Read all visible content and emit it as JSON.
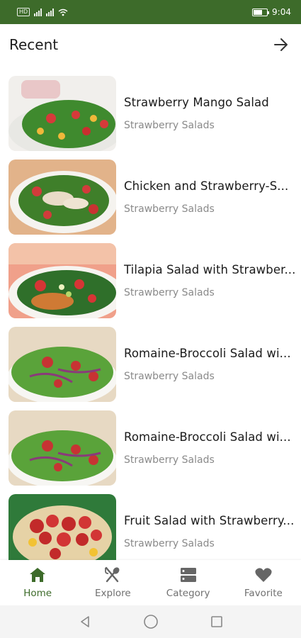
{
  "status_bar": {
    "left_badge": "HD",
    "time": "9:04",
    "icons": [
      "signal-icon",
      "signal-icon",
      "wifi-icon",
      "battery-icon"
    ]
  },
  "header": {
    "title": "Recent",
    "action_icon": "arrow-right-icon"
  },
  "recipes": [
    {
      "title": "Strawberry Mango Salad",
      "category": "Strawberry Salads"
    },
    {
      "title": "Chicken and Strawberry-S...",
      "category": "Strawberry Salads"
    },
    {
      "title": "Tilapia Salad with Strawber...",
      "category": "Strawberry Salads"
    },
    {
      "title": "Romaine-Broccoli Salad wi...",
      "category": "Strawberry Salads"
    },
    {
      "title": "Romaine-Broccoli Salad wi...",
      "category": "Strawberry Salads"
    },
    {
      "title": "Fruit Salad with Strawberry...",
      "category": "Strawberry Salads"
    }
  ],
  "bottom_nav": {
    "items": [
      {
        "label": "Home",
        "icon": "home-icon",
        "active": true
      },
      {
        "label": "Explore",
        "icon": "fork-spoon-icon",
        "active": false
      },
      {
        "label": "Category",
        "icon": "category-icon",
        "active": false
      },
      {
        "label": "Favorite",
        "icon": "heart-icon",
        "active": false
      }
    ]
  },
  "colors": {
    "primary": "#3d6b2a",
    "text": "#1b1b1b",
    "subtext": "#8a8a8a",
    "inactive_nav": "#707070"
  },
  "system_nav": [
    "back-icon",
    "home-circle-icon",
    "recents-icon"
  ]
}
